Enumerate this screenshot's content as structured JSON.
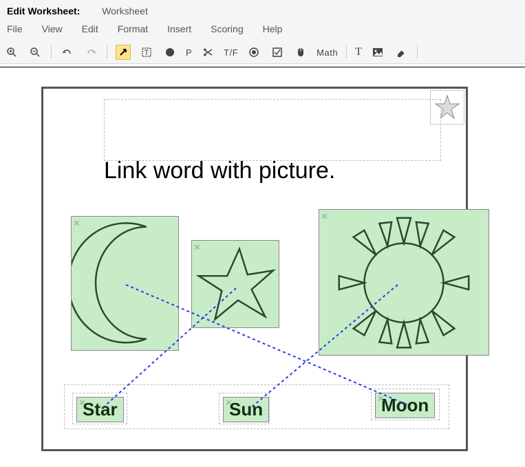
{
  "titlebar": {
    "label": "Edit Worksheet:",
    "name": "Worksheet"
  },
  "menubar": {
    "file": "File",
    "view": "View",
    "edit": "Edit",
    "format": "Format",
    "insert": "Insert",
    "scoring": "Scoring",
    "help": "Help"
  },
  "toolbar": {
    "paragraph": "P",
    "truefalse": "T/F",
    "math": "Math",
    "text": "T"
  },
  "worksheet": {
    "instruction": "Link word with picture.",
    "images": {
      "moon": "moon-shape",
      "star": "star-shape",
      "sun": "sun-shape"
    },
    "words": {
      "star": "Star",
      "sun": "Sun",
      "moon": "Moon"
    }
  }
}
